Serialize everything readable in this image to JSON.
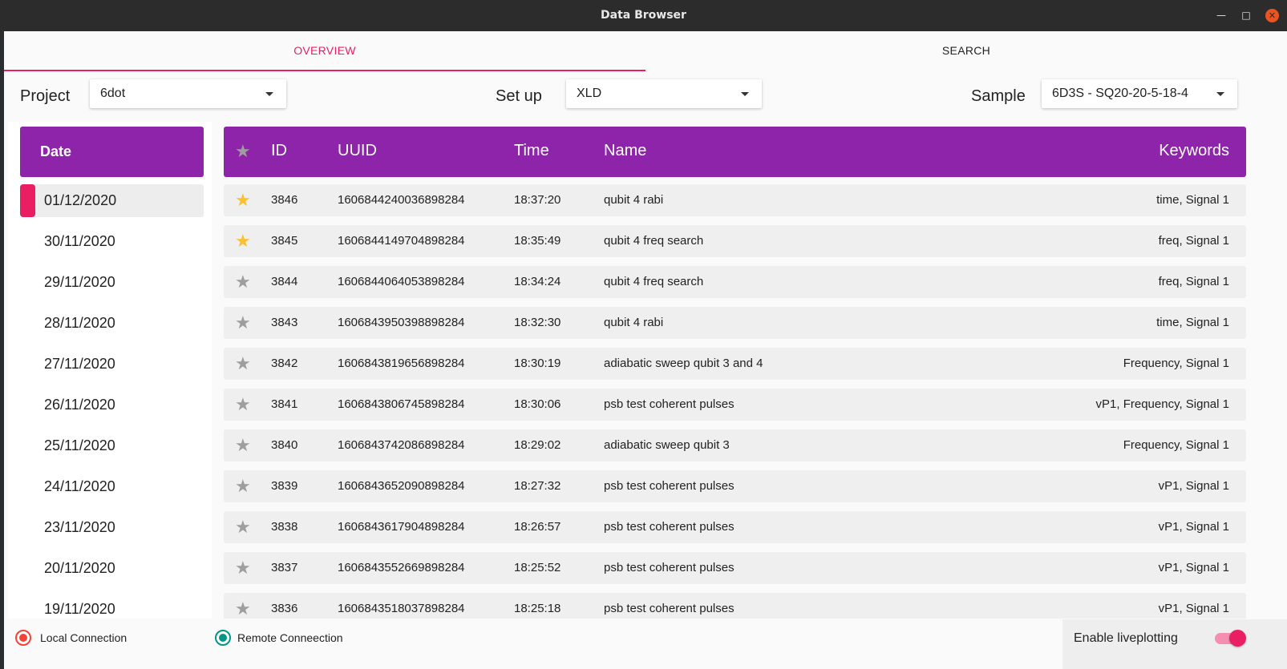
{
  "window": {
    "title": "Data Browser",
    "minimize_icon": "minimize-icon",
    "maximize_icon": "maximize-icon",
    "close_icon": "close-icon"
  },
  "tabs": [
    {
      "label": "OVERVIEW",
      "active": true
    },
    {
      "label": "SEARCH",
      "active": false
    }
  ],
  "selectors": {
    "project": {
      "label": "Project",
      "value": "6dot"
    },
    "setup": {
      "label": "Set up",
      "value": "XLD"
    },
    "sample": {
      "label": "Sample",
      "value": "6D3S - SQ20-20-5-18-4"
    }
  },
  "dates": {
    "header": "Date",
    "selected_index": 0,
    "items": [
      "01/12/2020",
      "30/11/2020",
      "29/11/2020",
      "28/11/2020",
      "27/11/2020",
      "26/11/2020",
      "25/11/2020",
      "24/11/2020",
      "23/11/2020",
      "20/11/2020",
      "19/11/2020"
    ]
  },
  "table": {
    "columns": {
      "star": "star-icon",
      "id": "ID",
      "uuid": "UUID",
      "time": "Time",
      "name": "Name",
      "keywords": "Keywords"
    },
    "rows": [
      {
        "starred": true,
        "id": "3846",
        "uuid": "1606844240036898284",
        "time": "18:37:20",
        "name": "qubit 4 rabi",
        "keywords": "time, Signal 1"
      },
      {
        "starred": true,
        "id": "3845",
        "uuid": "1606844149704898284",
        "time": "18:35:49",
        "name": "qubit 4 freq search",
        "keywords": "freq, Signal 1"
      },
      {
        "starred": false,
        "id": "3844",
        "uuid": "1606844064053898284",
        "time": "18:34:24",
        "name": "qubit 4 freq search",
        "keywords": "freq, Signal 1"
      },
      {
        "starred": false,
        "id": "3843",
        "uuid": "1606843950398898284",
        "time": "18:32:30",
        "name": "qubit 4 rabi",
        "keywords": "time, Signal 1"
      },
      {
        "starred": false,
        "id": "3842",
        "uuid": "1606843819656898284",
        "time": "18:30:19",
        "name": "adiabatic sweep qubit 3 and 4",
        "keywords": "Frequency, Signal 1"
      },
      {
        "starred": false,
        "id": "3841",
        "uuid": "1606843806745898284",
        "time": "18:30:06",
        "name": "psb test coherent pulses",
        "keywords": "vP1, Frequency, Signal 1"
      },
      {
        "starred": false,
        "id": "3840",
        "uuid": "1606843742086898284",
        "time": "18:29:02",
        "name": "adiabatic sweep qubit 3",
        "keywords": "Frequency, Signal 1"
      },
      {
        "starred": false,
        "id": "3839",
        "uuid": "1606843652090898284",
        "time": "18:27:32",
        "name": "psb test coherent pulses",
        "keywords": "vP1, Signal 1"
      },
      {
        "starred": false,
        "id": "3838",
        "uuid": "1606843617904898284",
        "time": "18:26:57",
        "name": "psb test coherent pulses",
        "keywords": "vP1, Signal 1"
      },
      {
        "starred": false,
        "id": "3837",
        "uuid": "1606843552669898284",
        "time": "18:25:52",
        "name": "psb test coherent pulses",
        "keywords": "vP1, Signal 1"
      },
      {
        "starred": false,
        "id": "3836",
        "uuid": "1606843518037898284",
        "time": "18:25:18",
        "name": "psb test coherent pulses",
        "keywords": "vP1, Signal 1"
      }
    ]
  },
  "footer": {
    "local_connection": "Local Connection",
    "remote_connection": "Remote Conneection",
    "liveplotting_label": "Enable liveplotting",
    "liveplotting_enabled": true
  },
  "colors": {
    "accent": "#e91e63",
    "header_purple": "#8e24aa",
    "star_on": "#fbc02d",
    "star_off": "#9e9e9e",
    "local_status": "#f44336",
    "remote_status": "#009688"
  }
}
